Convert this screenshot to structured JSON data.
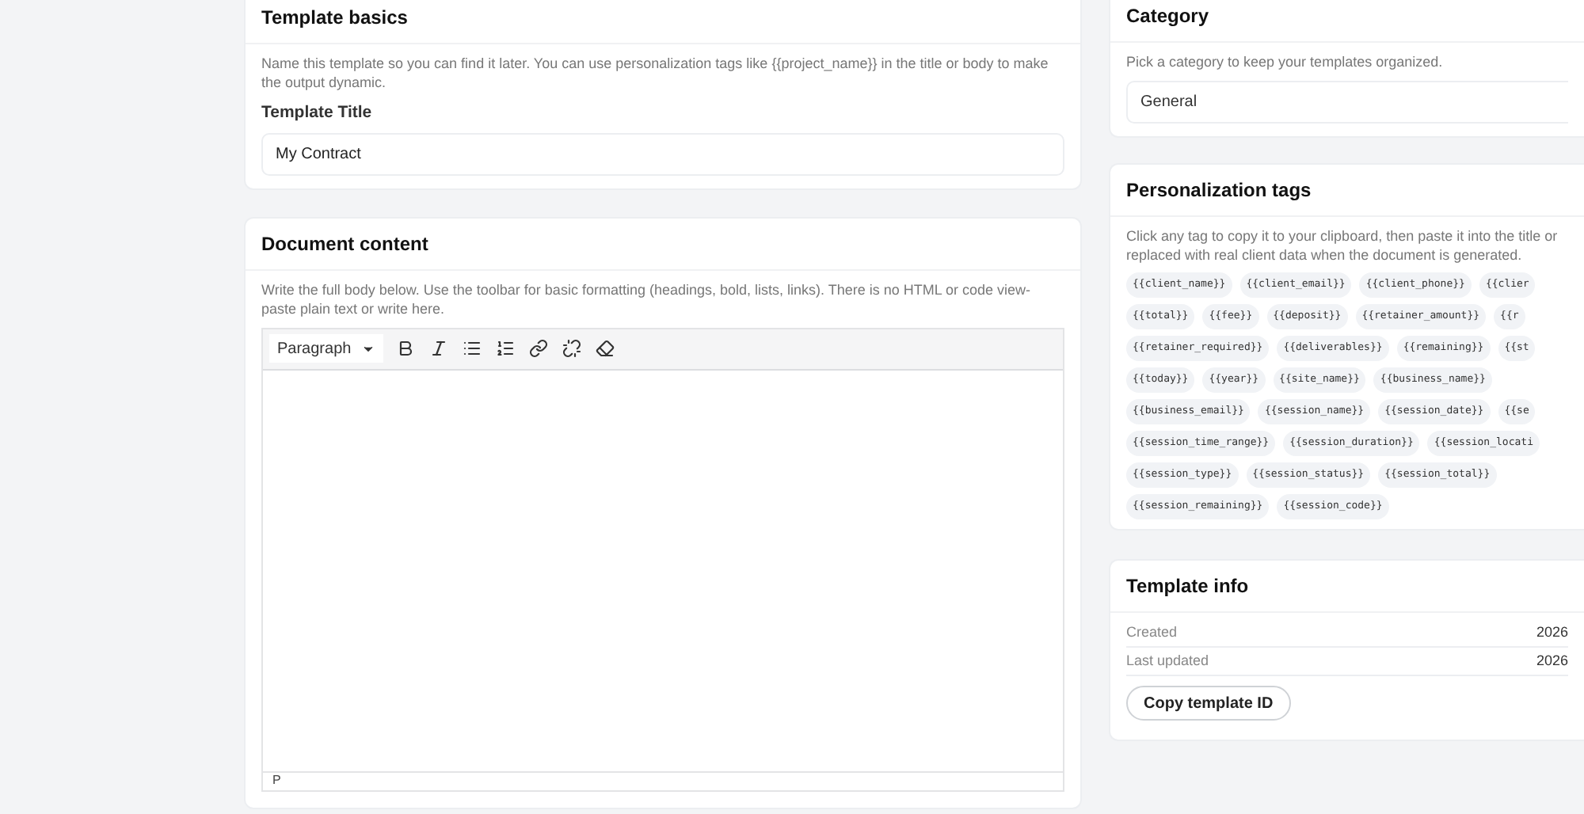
{
  "template_basics": {
    "title": "Template basics",
    "description": "Name this template so you can find it later. You can use personalization tags like {{project_name}} in the title or body to make the output dynamic.",
    "field_label": "Template Title",
    "field_value": "My Contract"
  },
  "document_content": {
    "title": "Document content",
    "description": "Write the full body below. Use the toolbar for basic formatting (headings, bold, lists, links). There is no HTML or code view-paste plain text or write here.",
    "block_format": "Paragraph",
    "toolbar": [
      {
        "kind": "bold"
      },
      {
        "kind": "italic"
      },
      {
        "kind": "bullets"
      },
      {
        "kind": "numbers"
      },
      {
        "kind": "link"
      },
      {
        "kind": "unlink"
      },
      {
        "kind": "eraser"
      }
    ],
    "status_path": "P"
  },
  "category": {
    "title": "Category",
    "description": "Pick a category to keep your templates organized.",
    "value": "General"
  },
  "personalization_tags": {
    "title": "Personalization tags",
    "description_lines": [
      "Click any tag to copy it to your clipboard, then paste it into the title or",
      "replaced with real client data when the document is generated."
    ],
    "tag_rows": [
      [
        "{{client_name}}",
        "{{client_email}}",
        "{{client_phone}}",
        "{{clier"
      ],
      [
        "{{total}}",
        "{{fee}}",
        "{{deposit}}",
        "{{retainer_amount}}",
        "{{r"
      ],
      [
        "{{retainer_required}}",
        "{{deliverables}}",
        "{{remaining}}",
        "{{st"
      ],
      [
        "{{today}}",
        "{{year}}",
        "{{site_name}}",
        "{{business_name}}"
      ],
      [
        "{{business_email}}",
        "{{session_name}}",
        "{{session_date}}",
        "{{se"
      ],
      [
        "{{session_time_range}}",
        "{{session_duration}}",
        "{{session_locati"
      ],
      [
        "{{session_type}}",
        "{{session_status}}",
        "{{session_total}}"
      ],
      [
        "{{session_remaining}}",
        "{{session_code}}"
      ]
    ]
  },
  "template_info": {
    "title": "Template info",
    "rows": [
      {
        "label": "Created",
        "value": "2026"
      },
      {
        "label": "Last updated",
        "value": "2026"
      }
    ],
    "button": "Copy template ID"
  }
}
